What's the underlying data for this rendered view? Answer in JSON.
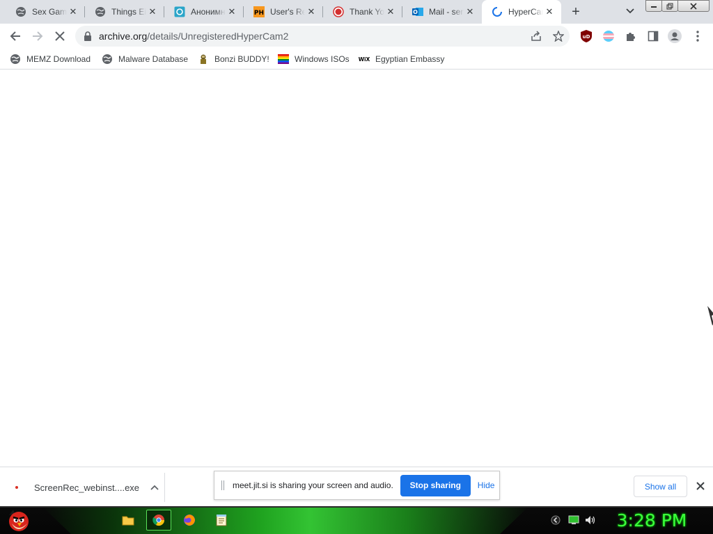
{
  "browser": {
    "tabs": [
      {
        "title": "Sex Gaming",
        "icon": "globe-icon"
      },
      {
        "title": "Things Either",
        "icon": "globe-icon"
      },
      {
        "title": "Анонимный",
        "icon": "chat-icon"
      },
      {
        "title": "User's Recent",
        "icon": "ph-icon"
      },
      {
        "title": "Thank You",
        "icon": "record-icon"
      },
      {
        "title": "Mail - sent",
        "icon": "outlook-icon"
      },
      {
        "title": "HyperCam",
        "icon": "loading-spinner-icon"
      }
    ],
    "active_tab_index": 6,
    "address": {
      "host": "archive.org",
      "path": "/details/UnregisteredHyperCam2"
    }
  },
  "bookmarks": [
    {
      "label": "MEMZ Download",
      "icon": "globe-icon"
    },
    {
      "label": "Malware Database",
      "icon": "globe-icon"
    },
    {
      "label": "Bonzi BUDDY!",
      "icon": "bonzi-icon"
    },
    {
      "label": "Windows ISOs",
      "icon": "rainbow-flag-icon"
    },
    {
      "label": "Egyptian Embassy",
      "icon": "wix-icon"
    }
  ],
  "bookmark_wix_text": "WiX",
  "extensions": {
    "ublock_text": "uD"
  },
  "download_shelf": {
    "file_name": "ScreenRec_webinst....exe",
    "share_message": "meet.jit.si is sharing your screen and audio.",
    "stop_label": "Stop sharing",
    "hide_label": "Hide",
    "show_all_label": "Show all"
  },
  "taskbar": {
    "clock": "3:28 PM",
    "apps": [
      "file-explorer-icon",
      "chrome-icon",
      "firefox-icon",
      "notepad-icon"
    ],
    "active_app_index": 1
  },
  "colors": {
    "accent_blue": "#1a73e8",
    "clock_green": "#3cff3c",
    "taskbar_glow": "#38d838"
  }
}
